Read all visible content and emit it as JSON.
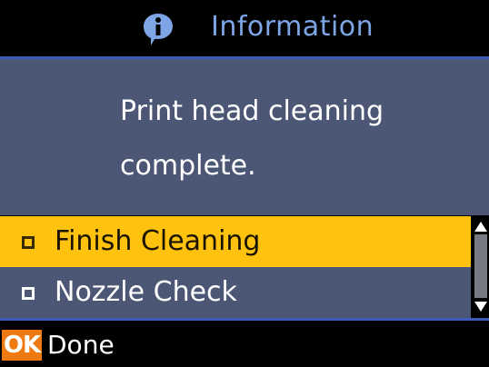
{
  "title_bar": {
    "icon": "info-icon",
    "title": "Information"
  },
  "message": {
    "line1": "Print head cleaning",
    "line2": "complete."
  },
  "options": [
    {
      "label": "Finish Cleaning",
      "selected": true
    },
    {
      "label": "Nozzle Check",
      "selected": false
    }
  ],
  "footer": {
    "ok_key": "OK",
    "action_label": "Done"
  },
  "colors": {
    "title_text": "#7EA6E6",
    "panel": "#4C5776",
    "highlight": "#FFC20E",
    "rule": "#3D5AB8",
    "ok_key": "#F07A12"
  }
}
